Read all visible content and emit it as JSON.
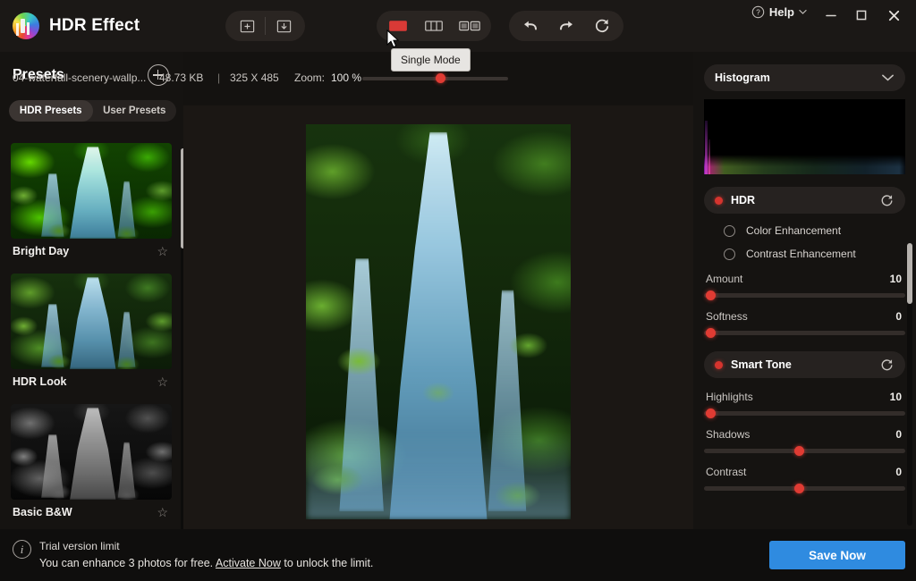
{
  "app": {
    "title": "HDR Effect",
    "logo_icon": "hdr-effect-logo"
  },
  "titlebar": {
    "help_label": "Help",
    "help_icon": "question-circle-icon",
    "help_chevron_icon": "chevron-down-icon",
    "minimize_icon": "minimize-icon",
    "maximize_icon": "maximize-icon",
    "close_icon": "close-icon"
  },
  "toolbar": {
    "file_buttons": [
      {
        "name": "open-image-button",
        "icon": "add-image-icon"
      },
      {
        "name": "save-image-button",
        "icon": "save-image-icon"
      }
    ],
    "mode_buttons": [
      {
        "name": "single-mode-button",
        "icon": "single-view-icon",
        "active": true
      },
      {
        "name": "split-mode-button",
        "icon": "split-view-icon",
        "active": false
      },
      {
        "name": "side-by-side-mode-button",
        "icon": "side-by-side-view-icon",
        "active": false
      }
    ],
    "history_buttons": [
      {
        "name": "undo-button",
        "icon": "undo-arrow-icon"
      },
      {
        "name": "redo-button",
        "icon": "redo-arrow-icon"
      },
      {
        "name": "reset-button",
        "icon": "refresh-circle-icon"
      }
    ],
    "tooltip": "Single Mode"
  },
  "presets": {
    "header": "Presets",
    "add_icon": "plus-circle-icon",
    "tabs": [
      {
        "label": "HDR Presets",
        "active": true
      },
      {
        "label": "User Presets",
        "active": false
      }
    ],
    "items": [
      {
        "name": "Bright Day",
        "style": "bright",
        "favorite_icon": "star-outline-icon"
      },
      {
        "name": "HDR Look",
        "style": "hdr",
        "favorite_icon": "star-outline-icon"
      },
      {
        "name": "Basic B&W",
        "style": "gray",
        "favorite_icon": "star-outline-icon"
      }
    ]
  },
  "image_info": {
    "file_name": "04-waterfall-scenery-wallp...",
    "file_size": "48.73 KB",
    "separator": "|",
    "dimensions": "325 X 485",
    "zoom_label": "Zoom:",
    "zoom_value": "100 %",
    "zoom_slider_percent": 50
  },
  "right_panel": {
    "histogram": {
      "title": "Histogram",
      "chevron_icon": "chevron-down-icon"
    },
    "hdr": {
      "title": "HDR",
      "led_icon": "toggle-led-icon",
      "reset_icon": "reset-circle-icon",
      "radios": [
        {
          "label": "Color Enhancement",
          "selected": false
        },
        {
          "label": "Contrast Enhancement",
          "selected": false
        }
      ],
      "sliders": [
        {
          "label": "Amount",
          "value": "10",
          "percent": 2
        },
        {
          "label": "Softness",
          "value": "0",
          "percent": 2
        }
      ]
    },
    "smart_tone": {
      "title": "Smart Tone",
      "led_icon": "toggle-led-icon",
      "reset_icon": "reset-circle-icon",
      "sliders": [
        {
          "label": "Highlights",
          "value": "10",
          "percent": 2
        },
        {
          "label": "Shadows",
          "value": "0",
          "percent": 50
        },
        {
          "label": "Contrast",
          "value": "0",
          "percent": 50
        }
      ]
    }
  },
  "bottom_bar": {
    "info_icon": "info-circle-icon",
    "title": "Trial version limit",
    "description_before": "You can enhance 3 photos for free. ",
    "link": "Activate Now",
    "description_after": " to unlock the limit.",
    "save_label": "Save Now",
    "save_color": "#2f8be0"
  }
}
